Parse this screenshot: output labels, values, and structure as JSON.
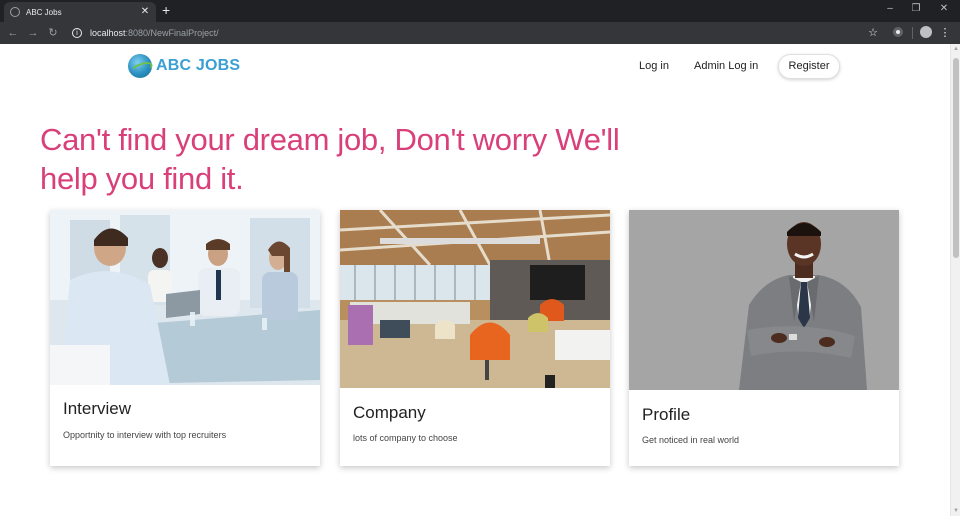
{
  "browser": {
    "tab_title": "ABC Jobs",
    "new_tab_symbol": "+",
    "url_host": "localhost",
    "url_rest": ":8080/NewFinalProject/"
  },
  "site": {
    "logo_text": "ABC JOBS",
    "nav": {
      "login": "Log in",
      "admin_login": "Admin Log in",
      "register": "Register"
    },
    "hero_line1": "Can't find your dream job, Don't worry We'll",
    "hero_line2": "help you find it.",
    "cards": [
      {
        "title": "Interview",
        "text": "Opportnity to interview with top recruiters"
      },
      {
        "title": "Company",
        "text": "lots of company to choose"
      },
      {
        "title": "Profile",
        "text": "Get noticed in real world"
      }
    ]
  },
  "icons": {
    "back": "back-arrow-icon",
    "forward": "forward-arrow-icon",
    "reload": "reload-icon",
    "info": "site-info-icon",
    "star": "bookmark-star-icon",
    "menu": "kebab-menu-icon"
  },
  "colors": {
    "accent_pink": "#d9407a",
    "logo_blue": "#3a9fd3",
    "chrome_dark": "#202124"
  }
}
